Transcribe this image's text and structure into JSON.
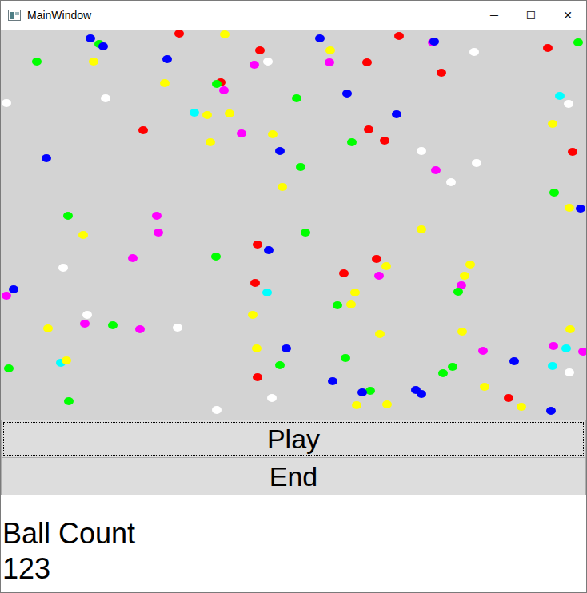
{
  "window": {
    "title": "MainWindow",
    "controls": [
      "─",
      "☐",
      "✕"
    ]
  },
  "canvas": {
    "balls": [
      {
        "color": "#ff0000"
      },
      {
        "color": "#0000ff"
      },
      {
        "color": "#00ff00"
      },
      {
        "color": "#ffff00"
      },
      {
        "color": "#ff00ff"
      },
      {
        "color": "#ffffff"
      },
      {
        "color": "#ffff00"
      },
      {
        "color": "#ff0000"
      },
      {
        "color": "#0000ff"
      },
      {
        "color": "#00ff00"
      },
      {
        "color": "#ffff00"
      },
      {
        "color": "#ff00ff"
      },
      {
        "color": "#ffffff"
      },
      {
        "color": "#00ffff"
      },
      {
        "color": "#ff0000"
      },
      {
        "color": "#0000ff"
      },
      {
        "color": "#00ff00"
      },
      {
        "color": "#ffff00"
      },
      {
        "color": "#ff00ff"
      },
      {
        "color": "#ffffff"
      },
      {
        "color": "#ffff00"
      },
      {
        "color": "#ff0000"
      },
      {
        "color": "#0000ff"
      },
      {
        "color": "#00ff00"
      },
      {
        "color": "#ffff00"
      },
      {
        "color": "#ff00ff"
      },
      {
        "color": "#ffffff"
      },
      {
        "color": "#00ffff"
      },
      {
        "color": "#ff0000"
      },
      {
        "color": "#0000ff"
      },
      {
        "color": "#00ff00"
      },
      {
        "color": "#ffff00"
      },
      {
        "color": "#ff00ff"
      },
      {
        "color": "#ffffff"
      },
      {
        "color": "#ffff00"
      },
      {
        "color": "#ff0000"
      },
      {
        "color": "#0000ff"
      },
      {
        "color": "#00ff00"
      },
      {
        "color": "#ffff00"
      },
      {
        "color": "#ff00ff"
      },
      {
        "color": "#ffffff"
      },
      {
        "color": "#00ffff"
      },
      {
        "color": "#ff0000"
      },
      {
        "color": "#0000ff"
      },
      {
        "color": "#00ff00"
      },
      {
        "color": "#ffff00"
      },
      {
        "color": "#ff00ff"
      },
      {
        "color": "#ffffff"
      },
      {
        "color": "#ffff00"
      },
      {
        "color": "#ff0000"
      },
      {
        "color": "#0000ff"
      },
      {
        "color": "#00ff00"
      },
      {
        "color": "#ffff00"
      },
      {
        "color": "#ff00ff"
      },
      {
        "color": "#ffffff"
      },
      {
        "color": "#00ffff"
      },
      {
        "color": "#ff0000"
      },
      {
        "color": "#0000ff"
      },
      {
        "color": "#00ff00"
      },
      {
        "color": "#ffff00"
      },
      {
        "color": "#ff00ff"
      },
      {
        "color": "#ffffff"
      },
      {
        "color": "#ffff00"
      },
      {
        "color": "#ff0000"
      },
      {
        "color": "#0000ff"
      },
      {
        "color": "#00ff00"
      },
      {
        "color": "#ffff00"
      },
      {
        "color": "#ff00ff"
      },
      {
        "color": "#ffffff"
      },
      {
        "color": "#00ffff"
      },
      {
        "color": "#ff0000"
      },
      {
        "color": "#0000ff"
      },
      {
        "color": "#00ff00"
      },
      {
        "color": "#ffff00"
      },
      {
        "color": "#ff00ff"
      },
      {
        "color": "#ffffff"
      },
      {
        "color": "#ffff00"
      },
      {
        "color": "#ff0000"
      },
      {
        "color": "#0000ff"
      },
      {
        "color": "#00ff00"
      },
      {
        "color": "#ffff00"
      },
      {
        "color": "#ff00ff"
      },
      {
        "color": "#ffffff"
      },
      {
        "color": "#00ffff"
      },
      {
        "color": "#ff0000"
      },
      {
        "color": "#0000ff"
      },
      {
        "color": "#00ff00"
      },
      {
        "color": "#ffff00"
      },
      {
        "color": "#ff00ff"
      },
      {
        "color": "#ffffff"
      },
      {
        "color": "#ffff00"
      },
      {
        "color": "#ff0000"
      },
      {
        "color": "#0000ff"
      },
      {
        "color": "#00ff00"
      },
      {
        "color": "#ffff00"
      },
      {
        "color": "#ff00ff"
      },
      {
        "color": "#ffffff"
      },
      {
        "color": "#ffff00"
      },
      {
        "color": "#ff0000"
      },
      {
        "color": "#0000ff"
      },
      {
        "color": "#00ff00"
      },
      {
        "color": "#ffff00"
      },
      {
        "color": "#ff00ff"
      },
      {
        "color": "#ffff00"
      },
      {
        "color": "#00ff00"
      },
      {
        "color": "#ff0000"
      },
      {
        "color": "#0000ff"
      },
      {
        "color": "#00ff00"
      },
      {
        "color": "#ffff00"
      },
      {
        "color": "#ff00ff"
      },
      {
        "color": "#ffff00"
      },
      {
        "color": "#00ff00"
      },
      {
        "color": "#ff0000"
      },
      {
        "color": "#0000ff"
      },
      {
        "color": "#00ff00"
      },
      {
        "color": "#ffff00"
      },
      {
        "color": "#0000ff"
      },
      {
        "color": "#ffff00"
      },
      {
        "color": "#00ff00"
      },
      {
        "color": "#ffff00"
      },
      {
        "color": "#0000ff"
      },
      {
        "color": "#ff00ff"
      },
      {
        "color": "#00ff00"
      }
    ]
  },
  "buttons": [
    {
      "label": "Play",
      "focused": true
    },
    {
      "label": "End",
      "focused": false
    }
  ],
  "ball_count": {
    "label": "Ball Count",
    "value": "123"
  }
}
